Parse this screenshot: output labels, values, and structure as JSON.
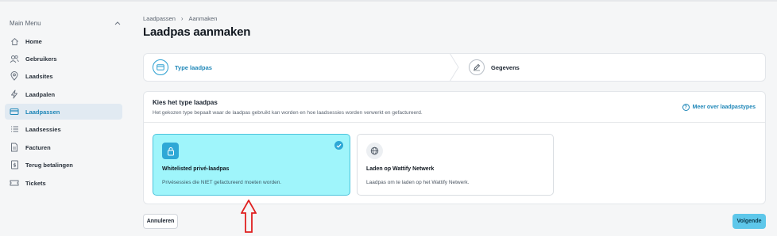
{
  "sidebar": {
    "menu_title": "Main Menu",
    "items": [
      {
        "label": "Home",
        "icon": "home-icon"
      },
      {
        "label": "Gebruikers",
        "icon": "users-icon"
      },
      {
        "label": "Laadsites",
        "icon": "map-pin-icon"
      },
      {
        "label": "Laadpalen",
        "icon": "bolt-icon"
      },
      {
        "label": "Laadpassen",
        "icon": "card-icon",
        "active": true
      },
      {
        "label": "Laadsessies",
        "icon": "list-icon"
      },
      {
        "label": "Facturen",
        "icon": "invoice-icon"
      },
      {
        "label": "Terug betalingen",
        "icon": "refund-icon"
      },
      {
        "label": "Tickets",
        "icon": "ticket-icon"
      }
    ]
  },
  "breadcrumb": {
    "parent": "Laadpassen",
    "current": "Aanmaken"
  },
  "page_title": "Laadpas aanmaken",
  "steps": [
    {
      "label": "Type laadpas",
      "icon": "card-icon",
      "active": true
    },
    {
      "label": "Gegevens",
      "icon": "edit-icon",
      "active": false
    }
  ],
  "card": {
    "title": "Kies het type laadpas",
    "subtitle": "Het gekozen type bepaalt waar de laadpas gebruikt kan worden en hoe laadsessies worden verwerkt en gefactureerd.",
    "more_link": "Meer over laadpastypes"
  },
  "options": [
    {
      "title": "Whitelisted privé-laadpas",
      "description": "Privésessies die NIET gefactureerd moeten worden.",
      "icon": "lock-icon",
      "selected": true
    },
    {
      "title": "Laden op Wattify Netwerk",
      "description": "Laadpas om te laden op het Wattify Netwerk.",
      "icon": "globe-icon",
      "selected": false
    }
  ],
  "buttons": {
    "cancel": "Annuleren",
    "next": "Volgende"
  },
  "colors": {
    "accent": "#1f87b8",
    "selected_bg": "#9ff5fb",
    "next_button": "#5ec7ea",
    "annotation_arrow": "#e02020"
  }
}
